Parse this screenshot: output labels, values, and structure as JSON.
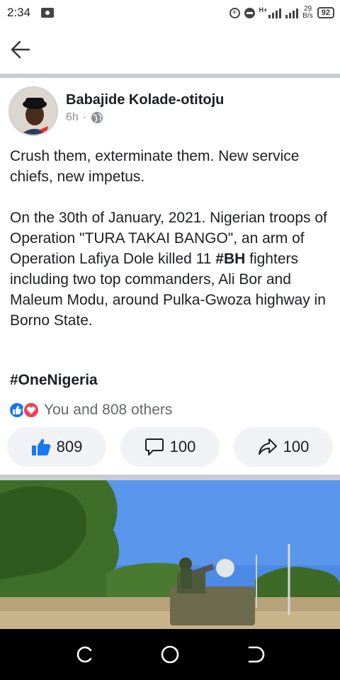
{
  "status_bar": {
    "time": "2:34",
    "network_type": "H+",
    "speed_value": "29",
    "speed_unit": "B/s",
    "battery": "92"
  },
  "header": {
    "back_icon": "arrow-left-icon"
  },
  "post": {
    "author": "Babajide Kolade-otitoju",
    "time_ago": "6h",
    "separator": "·",
    "privacy_icon": "globe-icon",
    "paragraph1": "Crush them, exterminate them. New service chiefs, new impetus.",
    "paragraph2_before": "On the 30th of January, 2021. Nigerian troops of Operation \"TURA TAKAI BANGO\", an arm of Operation Lafiya Dole killed 11 ",
    "paragraph2_bold": "#BH",
    "paragraph2_after": " fighters including two top commanders, Ali Bor and Maleum Modu, around  Pulka-Gwoza highway in Borno State.",
    "hashtag": "#OneNigeria",
    "reactions_text": "You and 808 others",
    "like_count": "809",
    "comment_count": "100",
    "share_count": "100"
  },
  "colors": {
    "like_blue": "#1877f2",
    "love_red": "#f33e58",
    "button_bg": "#f0f2f5",
    "divider": "#c9ccd1"
  }
}
